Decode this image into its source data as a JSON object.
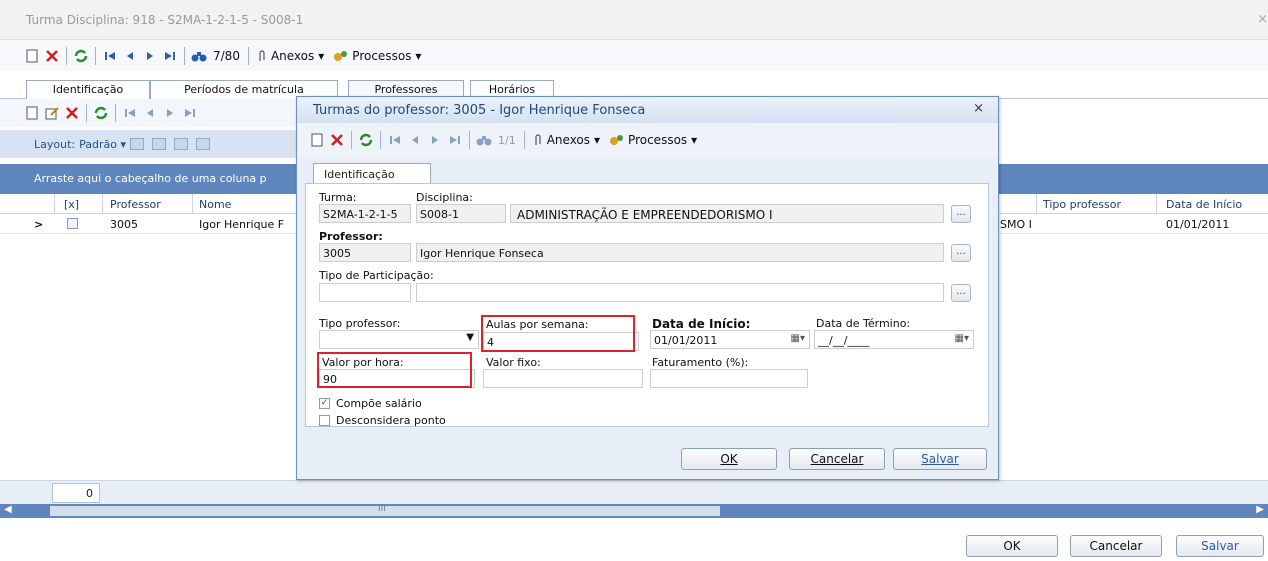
{
  "window": {
    "title": "Turma Disciplina: 918 - S2MA-1-2-1-5 - S008-1",
    "close": "×"
  },
  "toolbar": {
    "record_position": "7/80",
    "attachments_label": "Anexos",
    "processes_label": "Processos"
  },
  "tabs": [
    {
      "label": "Identificação"
    },
    {
      "label": "Períodos de matrícula"
    },
    {
      "label": "Professores"
    },
    {
      "label": "Horários"
    }
  ],
  "layout_bar": {
    "label": "Layout:",
    "preset": "Padrão"
  },
  "grid": {
    "group_hint": "Arraste aqui o cabeçalho de uma coluna p",
    "columns": [
      "[x]",
      "Professor",
      "Nome",
      "Tipo professor",
      "Data de Início"
    ],
    "rows": [
      {
        "indicator": ">",
        "professor": "3005",
        "nome": "Igor Henrique F",
        "disciplina_tail": "SMO I",
        "tipo": "",
        "data_inicio": "01/01/2011"
      }
    ],
    "footer_count": "0",
    "scroll_glyph": "III"
  },
  "bottom_buttons": {
    "ok": "OK",
    "cancel": "Cancelar",
    "save": "Salvar"
  },
  "modal": {
    "title": "Turmas do professor: 3005 - Igor Henrique Fonseca",
    "close": "×",
    "toolbar": {
      "record_position": "1/1",
      "attachments_label": "Anexos",
      "processes_label": "Processos"
    },
    "tab": "Identificação",
    "fields": {
      "turma_label": "Turma:",
      "turma_value": "S2MA-1-2-1-5",
      "disciplina_label": "Disciplina:",
      "disciplina_code": "S008-1",
      "disciplina_name": "ADMINISTRAÇÃO E EMPREENDEDORISMO I",
      "professor_label": "Professor:",
      "professor_code": "3005",
      "professor_name": "Igor Henrique Fonseca",
      "tipo_participacao_label": "Tipo de Participação:",
      "tipo_professor_label": "Tipo professor:",
      "aulas_label": "Aulas por semana:",
      "aulas_value": "4",
      "data_inicio_label": "Data de Início:",
      "data_inicio_value": "01/01/2011",
      "data_termino_label": "Data de Término:",
      "data_termino_value": "__/__/____",
      "valor_hora_label": "Valor por hora:",
      "valor_hora_value": "90",
      "valor_fixo_label": "Valor fixo:",
      "faturamento_label": "Faturamento (%):",
      "compoe_label": "Compõe salário",
      "desconsidera_label": "Desconsidera ponto",
      "ellipsis": "..."
    },
    "checkboxes": {
      "compoe_salario": true,
      "desconsidera_ponto": false
    },
    "buttons": {
      "ok": "OK",
      "cancel": "Cancelar",
      "save": "Salvar"
    }
  },
  "colors": {
    "grid_accent": "#5f86bd",
    "highlight": "#e0202a"
  }
}
